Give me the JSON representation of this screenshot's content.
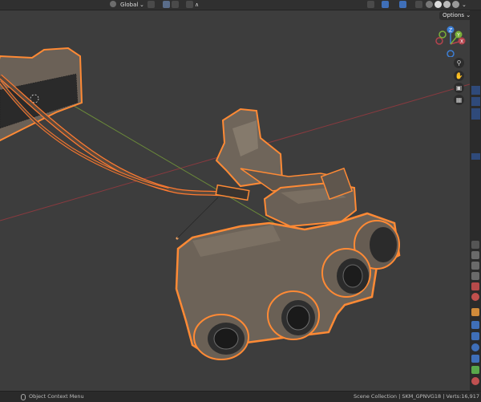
{
  "header": {
    "transform_orientation": "Global",
    "options_label": "Options"
  },
  "gizmo": {
    "z_label": "Z",
    "x_label": "X",
    "y_label": "Y"
  },
  "status": {
    "context_menu": "Object Context Menu",
    "scene_info": "Scene Collection | SKM_GPNVG18 | Verts:16,917"
  },
  "colors": {
    "x_axis": "#b4434d",
    "y_axis": "#7ab03a",
    "z_axis": "#3d7fd6",
    "selection_outline": "#ff8a35"
  },
  "icons": {
    "orientation": "globe-icon",
    "snap": "magnet-icon",
    "proportional": "proportional-edit-icon",
    "zoom": "magnifier-icon",
    "pan": "hand-icon",
    "camera": "camera-icon",
    "ortho": "grid-icon"
  }
}
